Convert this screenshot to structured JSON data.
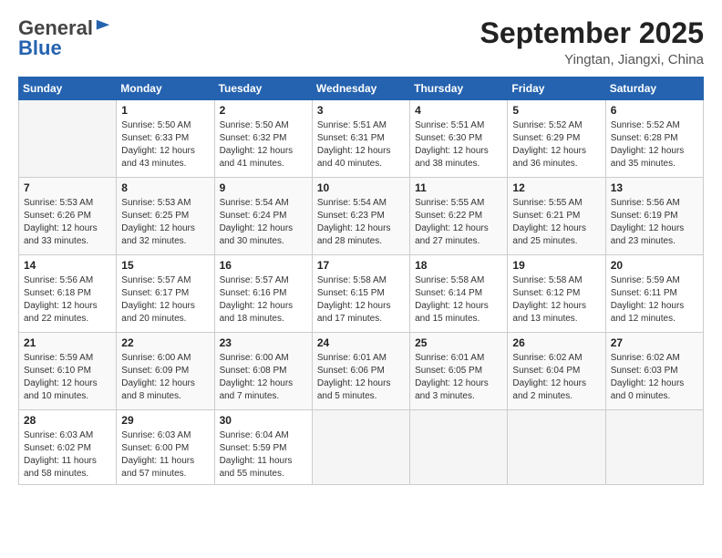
{
  "header": {
    "logo_general": "General",
    "logo_blue": "Blue",
    "month_title": "September 2025",
    "location": "Yingtan, Jiangxi, China"
  },
  "days_of_week": [
    "Sunday",
    "Monday",
    "Tuesday",
    "Wednesday",
    "Thursday",
    "Friday",
    "Saturday"
  ],
  "weeks": [
    [
      {
        "day": "",
        "info": ""
      },
      {
        "day": "1",
        "info": "Sunrise: 5:50 AM\nSunset: 6:33 PM\nDaylight: 12 hours\nand 43 minutes."
      },
      {
        "day": "2",
        "info": "Sunrise: 5:50 AM\nSunset: 6:32 PM\nDaylight: 12 hours\nand 41 minutes."
      },
      {
        "day": "3",
        "info": "Sunrise: 5:51 AM\nSunset: 6:31 PM\nDaylight: 12 hours\nand 40 minutes."
      },
      {
        "day": "4",
        "info": "Sunrise: 5:51 AM\nSunset: 6:30 PM\nDaylight: 12 hours\nand 38 minutes."
      },
      {
        "day": "5",
        "info": "Sunrise: 5:52 AM\nSunset: 6:29 PM\nDaylight: 12 hours\nand 36 minutes."
      },
      {
        "day": "6",
        "info": "Sunrise: 5:52 AM\nSunset: 6:28 PM\nDaylight: 12 hours\nand 35 minutes."
      }
    ],
    [
      {
        "day": "7",
        "info": "Sunrise: 5:53 AM\nSunset: 6:26 PM\nDaylight: 12 hours\nand 33 minutes."
      },
      {
        "day": "8",
        "info": "Sunrise: 5:53 AM\nSunset: 6:25 PM\nDaylight: 12 hours\nand 32 minutes."
      },
      {
        "day": "9",
        "info": "Sunrise: 5:54 AM\nSunset: 6:24 PM\nDaylight: 12 hours\nand 30 minutes."
      },
      {
        "day": "10",
        "info": "Sunrise: 5:54 AM\nSunset: 6:23 PM\nDaylight: 12 hours\nand 28 minutes."
      },
      {
        "day": "11",
        "info": "Sunrise: 5:55 AM\nSunset: 6:22 PM\nDaylight: 12 hours\nand 27 minutes."
      },
      {
        "day": "12",
        "info": "Sunrise: 5:55 AM\nSunset: 6:21 PM\nDaylight: 12 hours\nand 25 minutes."
      },
      {
        "day": "13",
        "info": "Sunrise: 5:56 AM\nSunset: 6:19 PM\nDaylight: 12 hours\nand 23 minutes."
      }
    ],
    [
      {
        "day": "14",
        "info": "Sunrise: 5:56 AM\nSunset: 6:18 PM\nDaylight: 12 hours\nand 22 minutes."
      },
      {
        "day": "15",
        "info": "Sunrise: 5:57 AM\nSunset: 6:17 PM\nDaylight: 12 hours\nand 20 minutes."
      },
      {
        "day": "16",
        "info": "Sunrise: 5:57 AM\nSunset: 6:16 PM\nDaylight: 12 hours\nand 18 minutes."
      },
      {
        "day": "17",
        "info": "Sunrise: 5:58 AM\nSunset: 6:15 PM\nDaylight: 12 hours\nand 17 minutes."
      },
      {
        "day": "18",
        "info": "Sunrise: 5:58 AM\nSunset: 6:14 PM\nDaylight: 12 hours\nand 15 minutes."
      },
      {
        "day": "19",
        "info": "Sunrise: 5:58 AM\nSunset: 6:12 PM\nDaylight: 12 hours\nand 13 minutes."
      },
      {
        "day": "20",
        "info": "Sunrise: 5:59 AM\nSunset: 6:11 PM\nDaylight: 12 hours\nand 12 minutes."
      }
    ],
    [
      {
        "day": "21",
        "info": "Sunrise: 5:59 AM\nSunset: 6:10 PM\nDaylight: 12 hours\nand 10 minutes."
      },
      {
        "day": "22",
        "info": "Sunrise: 6:00 AM\nSunset: 6:09 PM\nDaylight: 12 hours\nand 8 minutes."
      },
      {
        "day": "23",
        "info": "Sunrise: 6:00 AM\nSunset: 6:08 PM\nDaylight: 12 hours\nand 7 minutes."
      },
      {
        "day": "24",
        "info": "Sunrise: 6:01 AM\nSunset: 6:06 PM\nDaylight: 12 hours\nand 5 minutes."
      },
      {
        "day": "25",
        "info": "Sunrise: 6:01 AM\nSunset: 6:05 PM\nDaylight: 12 hours\nand 3 minutes."
      },
      {
        "day": "26",
        "info": "Sunrise: 6:02 AM\nSunset: 6:04 PM\nDaylight: 12 hours\nand 2 minutes."
      },
      {
        "day": "27",
        "info": "Sunrise: 6:02 AM\nSunset: 6:03 PM\nDaylight: 12 hours\nand 0 minutes."
      }
    ],
    [
      {
        "day": "28",
        "info": "Sunrise: 6:03 AM\nSunset: 6:02 PM\nDaylight: 11 hours\nand 58 minutes."
      },
      {
        "day": "29",
        "info": "Sunrise: 6:03 AM\nSunset: 6:00 PM\nDaylight: 11 hours\nand 57 minutes."
      },
      {
        "day": "30",
        "info": "Sunrise: 6:04 AM\nSunset: 5:59 PM\nDaylight: 11 hours\nand 55 minutes."
      },
      {
        "day": "",
        "info": ""
      },
      {
        "day": "",
        "info": ""
      },
      {
        "day": "",
        "info": ""
      },
      {
        "day": "",
        "info": ""
      }
    ]
  ]
}
